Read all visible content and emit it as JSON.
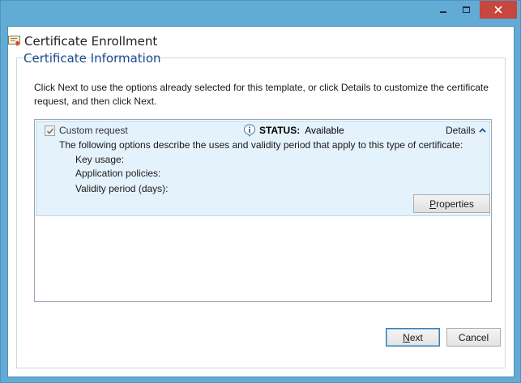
{
  "window": {
    "title": "Certificate Enrollment",
    "controls": {
      "minimize": "minimize",
      "maximize": "maximize",
      "close": "close"
    }
  },
  "page": {
    "section_title": "Certificate Information",
    "instructions": "Click Next to use the options already selected for this template, or click Details to customize the certificate request, and then click Next."
  },
  "certificate_item": {
    "checked": true,
    "name": "Custom request",
    "status_label": "STATUS:",
    "status_value": "Available",
    "details_link": "Details",
    "description": "The following options describe the uses and validity period that apply to this type of certificate:",
    "properties": [
      {
        "label": "Key usage:"
      },
      {
        "label": "Application policies:"
      },
      {
        "label": "Validity period (days):"
      }
    ],
    "properties_button": {
      "accel": "P",
      "rest": "roperties"
    }
  },
  "footer": {
    "next_button": {
      "accel": "N",
      "rest": "ext"
    },
    "cancel_button": "Cancel"
  },
  "colors": {
    "title_bar": "#62abd5",
    "close_button": "#c7463d",
    "section_title": "#1e4b8c",
    "item_highlight": "#e4f2fb"
  },
  "icons": {
    "app": "certificate-icon",
    "status": "info-icon",
    "details_toggle": "chevron-up-icon"
  }
}
